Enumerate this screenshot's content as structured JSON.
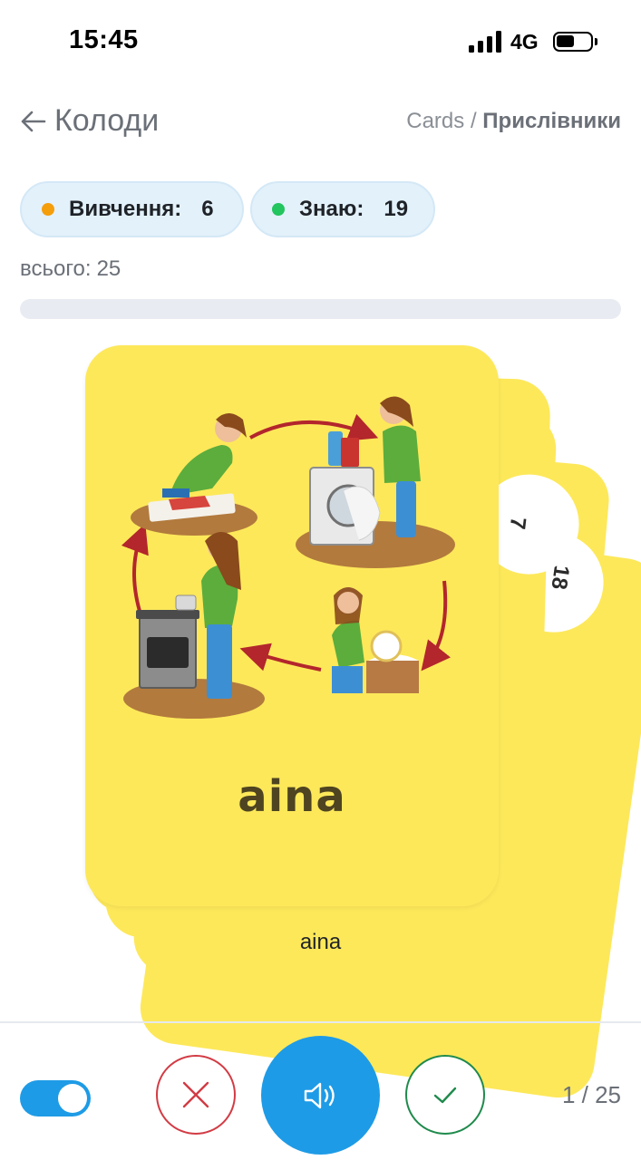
{
  "status_bar": {
    "time": "15:45",
    "network": "4G",
    "battery_level": 0.55
  },
  "header": {
    "back_label": "Колоди",
    "breadcrumb_root": "Cards",
    "breadcrumb_separator": " / ",
    "breadcrumb_current": "Прислівники"
  },
  "stats": {
    "learning_label": "Вивчення:",
    "learning_count": "6",
    "learning_color": "#f59e0b",
    "know_label": "Знаю:",
    "know_count": "19",
    "know_color": "#22c55e",
    "total_label": "всього:",
    "total_value": "25"
  },
  "progress": {
    "fraction": 0
  },
  "card": {
    "word": "aina",
    "illustration": "housework-cycle-illustration",
    "background_color": "#fde85a",
    "back_card_numbers": [
      "7",
      "18"
    ]
  },
  "caption": "aina",
  "controls": {
    "toggle_on": true,
    "wrong_icon": "close-icon",
    "sound_icon": "speaker-icon",
    "right_icon": "check-icon",
    "counter": "1 / 25"
  },
  "colors": {
    "accent": "#1e9be6",
    "wrong": "#d23b44",
    "right": "#1f8a4c"
  }
}
